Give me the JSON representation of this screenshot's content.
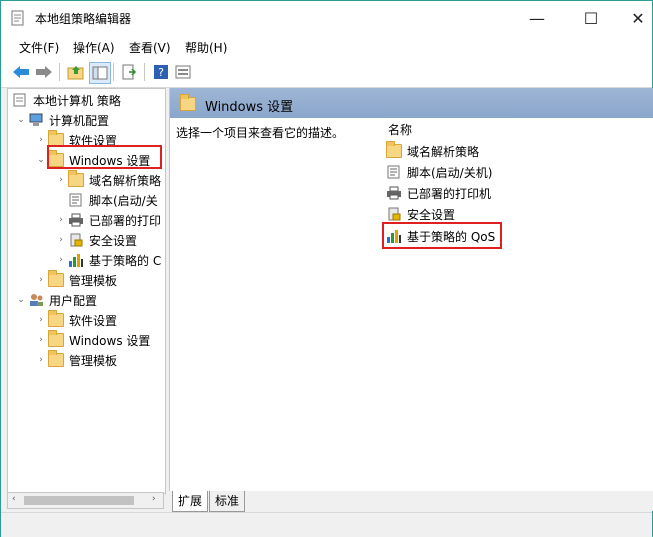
{
  "window": {
    "title": "本地组策略编辑器",
    "minimize": "—",
    "maximize": "☐",
    "close": "✕"
  },
  "menu": [
    "文件(F)",
    "操作(A)",
    "查看(V)",
    "帮助(H)"
  ],
  "tree": {
    "root": "本地计算机 策略",
    "computer_config": "计算机配置",
    "software_settings": "软件设置",
    "windows_settings": "Windows 设置",
    "dns_policy": "域名解析策略",
    "scripts": "脚本(启动/关",
    "printers": "已部署的打印",
    "security": "安全设置",
    "qos": "基于策略的 C",
    "admin_templates": "管理模板",
    "user_config": "用户配置",
    "user_software": "软件设置",
    "user_windows": "Windows 设置",
    "user_admin": "管理模板"
  },
  "right": {
    "header": "Windows 设置",
    "description": "选择一个项目来查看它的描述。",
    "column_name": "名称",
    "items": [
      "域名解析策略",
      "脚本(启动/关机)",
      "已部署的打印机",
      "安全设置",
      "基于策略的 QoS"
    ]
  },
  "tabs": [
    "扩展",
    "标准"
  ],
  "colors": {
    "highlight": "#e02020",
    "header": "#9fb6d5"
  }
}
